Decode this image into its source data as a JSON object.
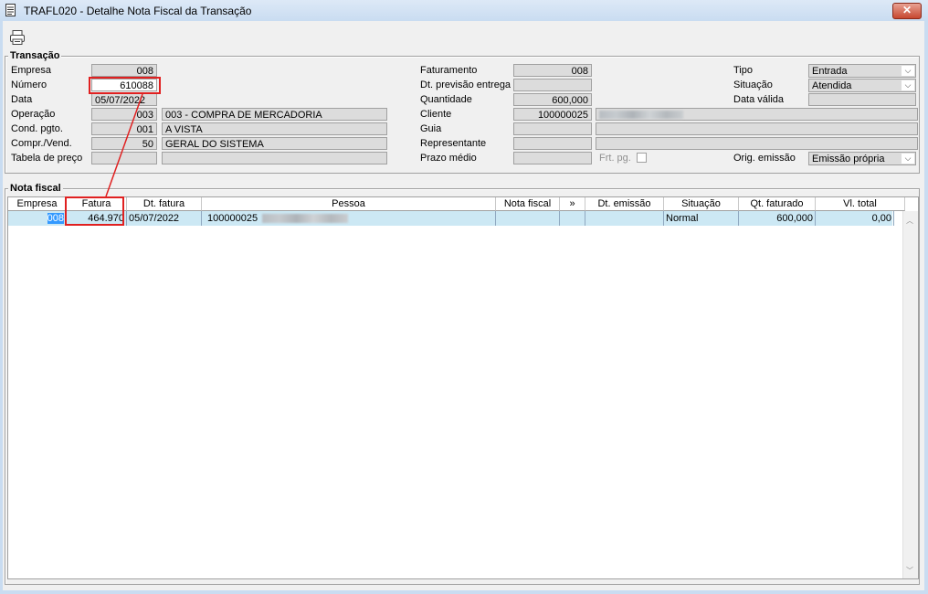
{
  "window": {
    "title": "TRAFL020 - Detalhe Nota Fiscal da Transação",
    "close_label": "✕"
  },
  "transacao": {
    "title": "Transação",
    "empresa": {
      "label": "Empresa",
      "value": "008"
    },
    "numero": {
      "label": "Número",
      "value": "610088"
    },
    "data": {
      "label": "Data",
      "value": "05/07/2022"
    },
    "operacao": {
      "label": "Operação",
      "code": "003",
      "desc": "003 - COMPRA DE MERCADORIA"
    },
    "cond_pgto": {
      "label": "Cond. pgto.",
      "code": "001",
      "desc": "A VISTA"
    },
    "compr_vend": {
      "label": "Compr./Vend.",
      "code": "50",
      "desc": "GERAL DO SISTEMA"
    },
    "tabela_preco": {
      "label": "Tabela de preço",
      "code": "",
      "desc": ""
    },
    "faturamento": {
      "label": "Faturamento",
      "value": "008"
    },
    "dt_previsao": {
      "label": "Dt. previsão entrega",
      "value": ""
    },
    "quantidade": {
      "label": "Quantidade",
      "value": "600,000"
    },
    "cliente": {
      "label": "Cliente",
      "value": "100000025"
    },
    "guia": {
      "label": "Guia",
      "value": ""
    },
    "representante": {
      "label": "Representante",
      "value": ""
    },
    "prazo_medio": {
      "label": "Prazo médio",
      "value": ""
    },
    "frt_pg": {
      "label": "Frt. pg."
    },
    "tipo": {
      "label": "Tipo",
      "value": "Entrada"
    },
    "situacao": {
      "label": "Situação",
      "value": "Atendida"
    },
    "data_valida": {
      "label": "Data válida",
      "value": ""
    },
    "orig_emissao": {
      "label": "Orig. emissão",
      "value": "Emissão própria"
    }
  },
  "nota_fiscal": {
    "title": "Nota fiscal",
    "columns": [
      "Empresa",
      "Fatura",
      "Dt. fatura",
      "Pessoa",
      "Nota fiscal",
      "»",
      "Dt. emissão",
      "Situação",
      "Qt. faturado",
      "Vl. total"
    ],
    "rows": [
      {
        "empresa": "008",
        "fatura": "464.970",
        "dt_fatura": "05/07/2022",
        "pessoa": "100000025",
        "nota_fiscal": "",
        "extra": "",
        "dt_emissao": "",
        "situacao": "Normal",
        "qt_faturado": "600,000",
        "vl_total": "0,00"
      }
    ]
  },
  "icons": {
    "print": "printer-icon",
    "document": "document-icon",
    "combo": "chevron-down-icon"
  },
  "colors": {
    "selection": "#3399ff",
    "row_highlight": "#cce8f4",
    "annotation": "#e02020"
  }
}
